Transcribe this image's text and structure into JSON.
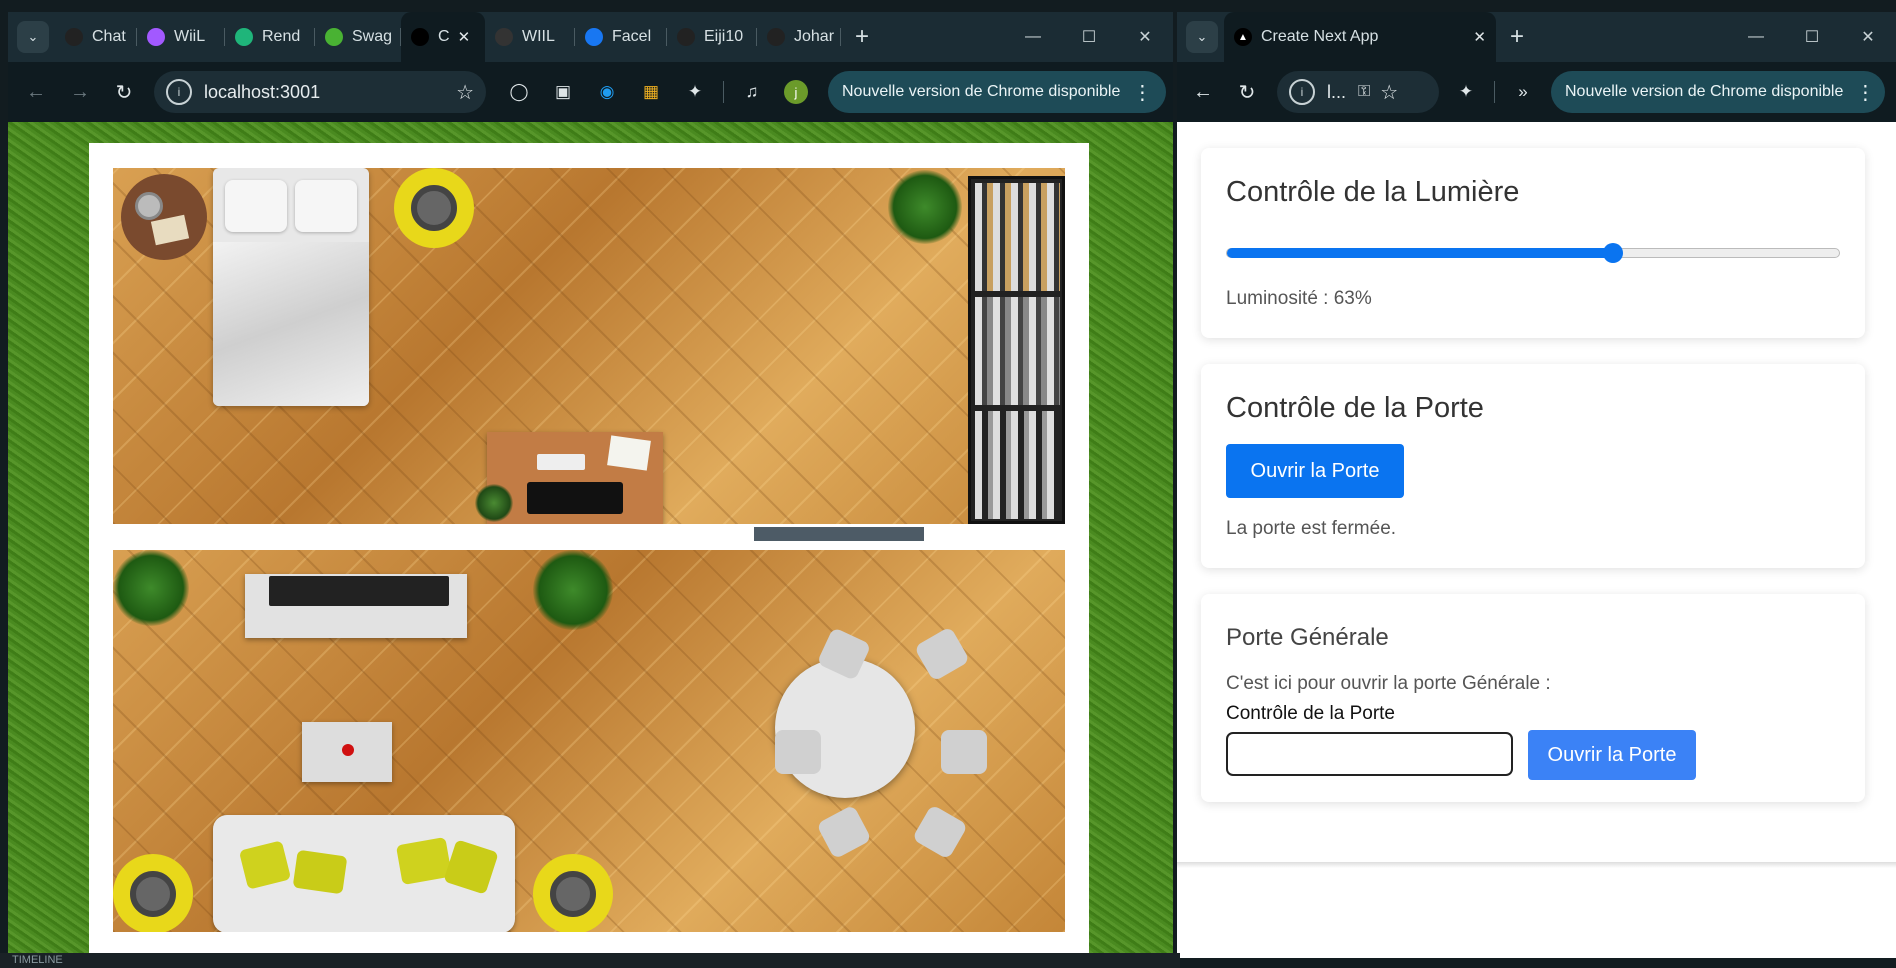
{
  "left_window": {
    "tabs": [
      {
        "label": "Chat",
        "icon": "chatgpt-icon",
        "color": "#222"
      },
      {
        "label": "WiiL",
        "icon": "figma-icon",
        "color": "#a259ff"
      },
      {
        "label": "Rend",
        "icon": "render-icon",
        "color": "#1fb57a"
      },
      {
        "label": "Swag",
        "icon": "swagger-icon",
        "color": "#49b233"
      },
      {
        "label": "C",
        "icon": "nextjs-icon",
        "color": "#000",
        "active": true
      },
      {
        "label": "WIIL",
        "icon": "app-icon",
        "color": "#333"
      },
      {
        "label": "Facel",
        "icon": "facebook-icon",
        "color": "#1877f2"
      },
      {
        "label": "Eiji10",
        "icon": "github-icon",
        "color": "#222"
      },
      {
        "label": "Johar",
        "icon": "github-icon",
        "color": "#222"
      }
    ],
    "url": "localhost:3001",
    "update_label": "Nouvelle version de Chrome disponible",
    "profile_initial": "j"
  },
  "right_window": {
    "tab_title": "Create Next App",
    "url_short": "l...",
    "update_label": "Nouvelle version de Chrome disponible"
  },
  "app": {
    "light": {
      "title": "Contrôle de la Lumière",
      "value_label": "Luminosité : 63%",
      "value": 63
    },
    "door": {
      "title": "Contrôle de la Porte",
      "button": "Ouvrir la Porte",
      "status": "La porte est fermée."
    },
    "main_door": {
      "title": "Porte Générale",
      "desc": "C'est ici pour ouvrir la porte Générale :",
      "field_label": "Contrôle de la Porte",
      "input_value": "",
      "button": "Ouvrir la Porte"
    }
  },
  "taskbar_label": "TIMELINE",
  "colors": {
    "primary_blue": "#0a74f0",
    "secondary_blue": "#3b82f6",
    "chrome_dark": "#0f1b20",
    "update_pill": "#1e4b57"
  }
}
